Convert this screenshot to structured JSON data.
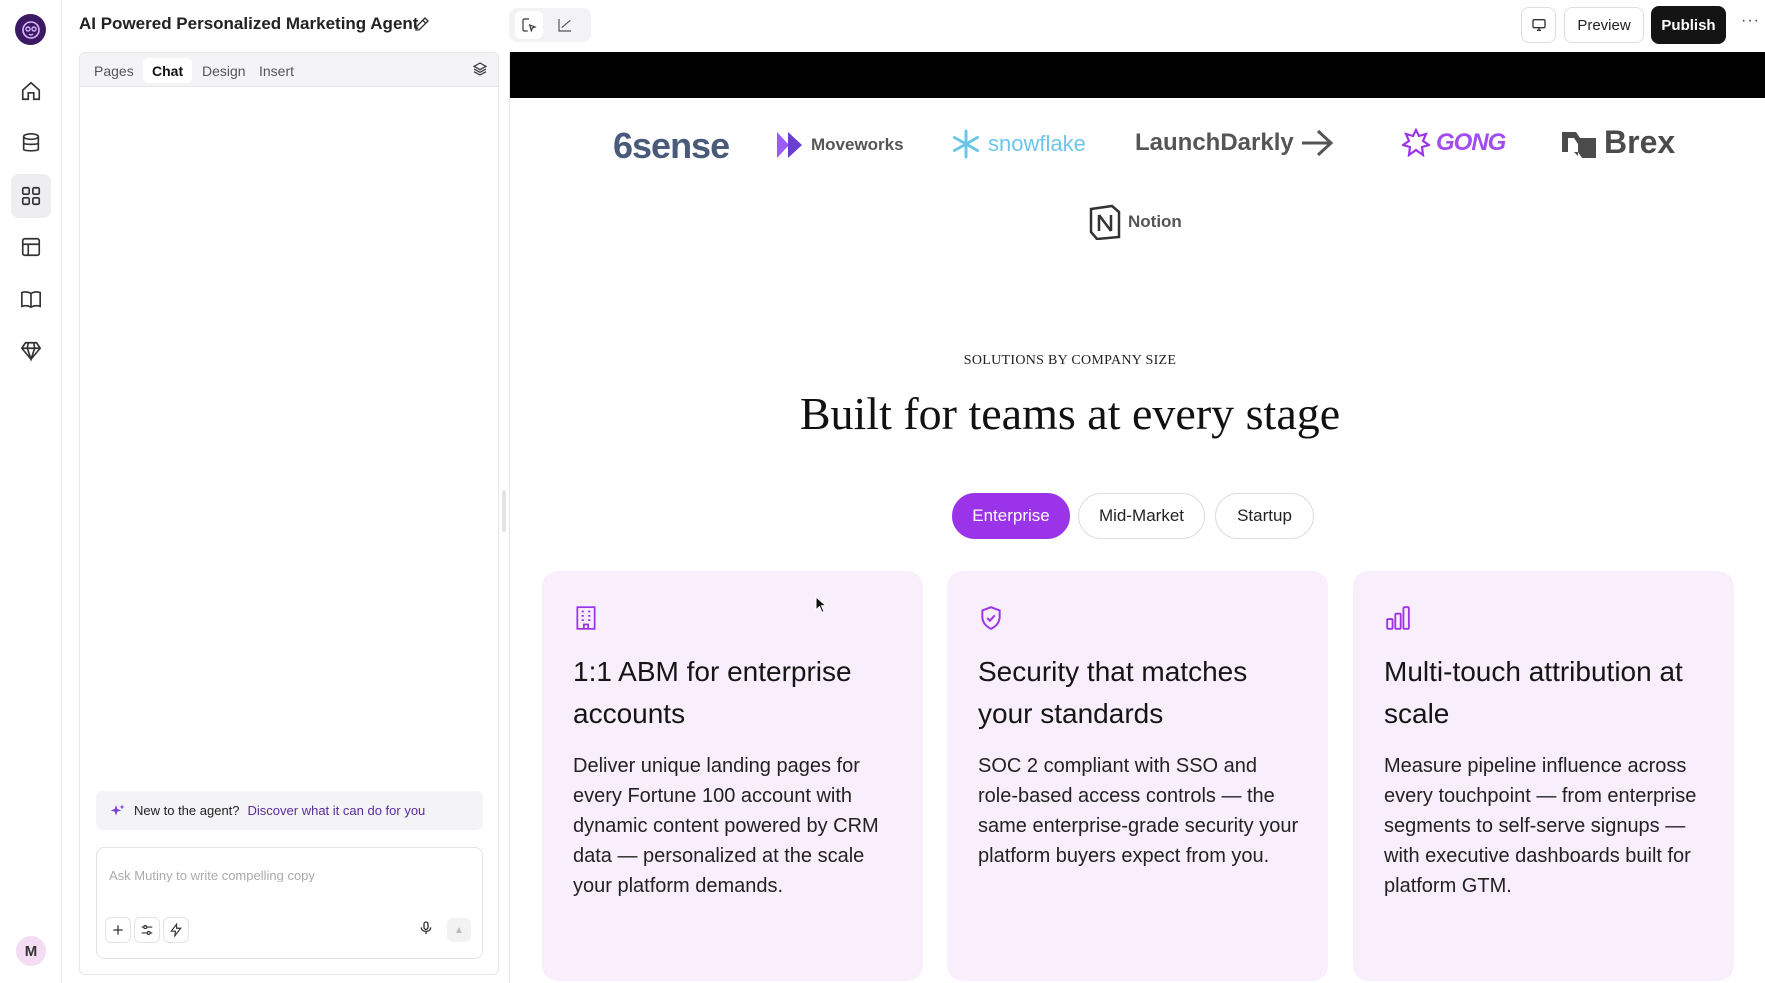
{
  "app": {
    "title": "AI Powered Personalized Marketing Agent",
    "avatar_initial": "M"
  },
  "rail": {
    "items": [
      {
        "icon": "home-icon"
      },
      {
        "icon": "database-icon"
      },
      {
        "icon": "grid-icon",
        "active": true
      },
      {
        "icon": "layout-icon"
      },
      {
        "icon": "book-icon"
      },
      {
        "icon": "diamond-icon"
      }
    ]
  },
  "toolbar": {
    "preview_label": "Preview",
    "publish_label": "Publish",
    "more_label": "···"
  },
  "panel": {
    "tabs": [
      {
        "label": "Pages",
        "selected": false
      },
      {
        "label": "Chat",
        "selected": true
      },
      {
        "label": "Design",
        "selected": false
      },
      {
        "label": "Insert",
        "selected": false
      }
    ],
    "hint_text": "New to the agent?",
    "hint_link": "Discover what it can do for you",
    "composer_placeholder": "Ask Mutiny to write compelling copy"
  },
  "canvas": {
    "logos": [
      "6sense",
      "Moveworks",
      "snowflake",
      "LaunchDarkly",
      "GONG",
      "Brex",
      "Notion"
    ],
    "eyebrow": "SOLUTIONS BY COMPANY SIZE",
    "headline": "Built for teams at every stage",
    "segments": [
      {
        "label": "Enterprise",
        "selected": true
      },
      {
        "label": "Mid-Market",
        "selected": false
      },
      {
        "label": "Startup",
        "selected": false
      }
    ],
    "cards": [
      {
        "icon": "building-icon",
        "title": "1:1 ABM for enterprise accounts",
        "body": "Deliver unique landing pages for every Fortune 100 account with dynamic content powered by CRM data — personalized at the scale your platform demands."
      },
      {
        "icon": "shield-check-icon",
        "title": "Security that matches your standards",
        "body": "SOC 2 compliant with SSO and role-based access controls — the same enterprise-grade security your platform buyers expect from you."
      },
      {
        "icon": "bar-chart-icon",
        "title": "Multi-touch attribution at scale",
        "body": "Measure pipeline influence across every touchpoint — from enterprise segments to self-serve signups — with executive dashboards built for platform GTM."
      }
    ]
  },
  "colors": {
    "accent": "#9b34e8",
    "card_bg": "#f9eefb",
    "logo_purple": "#7b3fd9"
  }
}
